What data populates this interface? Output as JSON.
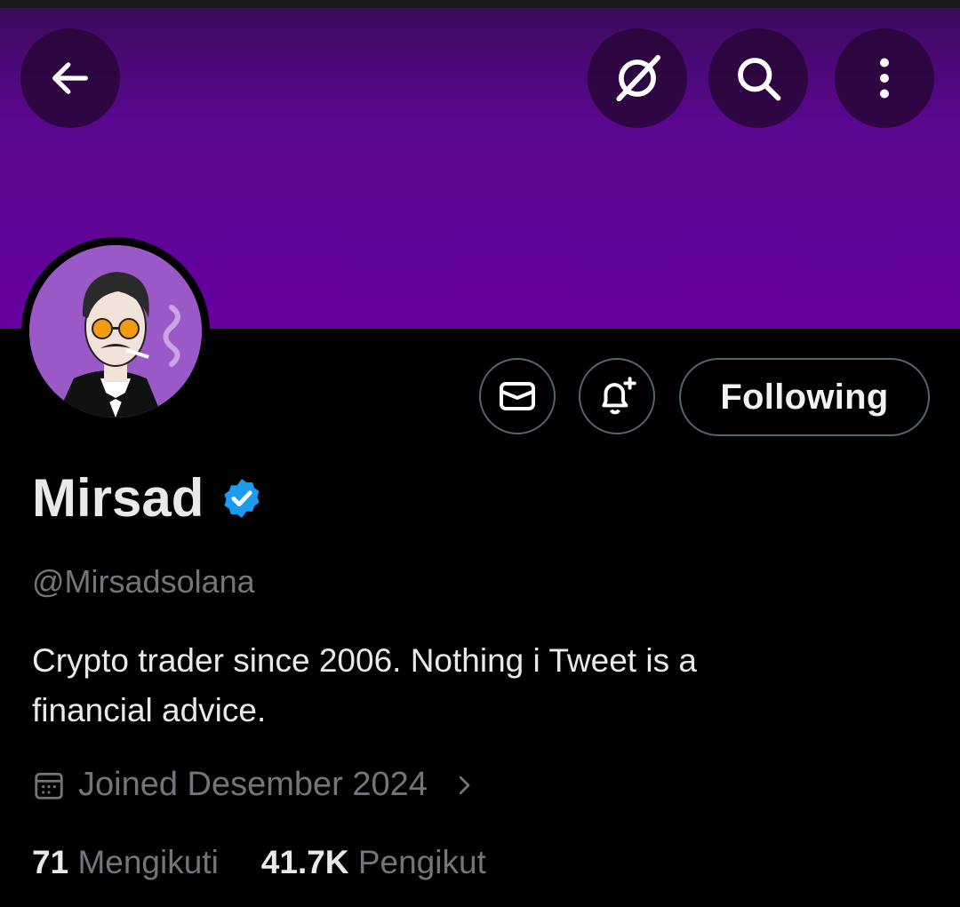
{
  "profile": {
    "name": "Mirsad",
    "handle": "@Mirsadsolana",
    "bio_line1": "Crypto trader since 2006. Nothing i Tweet is a",
    "bio_line2": "financial advice.",
    "joined": "Joined Desember 2024",
    "following_count": "71",
    "following_label": "Mengikuti",
    "followers_count": "41.7K",
    "followers_label": "Pengikut"
  },
  "actions": {
    "follow_label": "Following"
  },
  "icons": {
    "back": "arrow-left-icon",
    "grok": "grok-icon",
    "search": "search-icon",
    "more": "more-vertical-icon",
    "message": "envelope-icon",
    "notify": "bell-plus-icon",
    "verified": "verified-badge-icon",
    "calendar": "calendar-icon",
    "chevron": "chevron-right-icon"
  },
  "colors": {
    "banner": "#66009e",
    "verified": "#1d9bf0",
    "muted": "#71767b",
    "border": "#536471"
  }
}
